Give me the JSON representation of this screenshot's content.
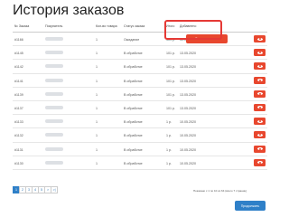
{
  "page_title": "История заказов",
  "columns": {
    "number": "№ Заказа",
    "buyer": "Покупатель",
    "qty": "Кол-во товара",
    "status": "Статус заказа",
    "sum": "Итого",
    "added": "Добавлено"
  },
  "rows": [
    {
      "num": "#1166",
      "qty": "1",
      "status": "Ожидание",
      "sum": "101 р.",
      "date": "30.05.2020"
    },
    {
      "num": "#1145",
      "qty": "1",
      "status": "В обработке",
      "sum": "101 р.",
      "date": "13.05.2020"
    },
    {
      "num": "#1142",
      "qty": "1",
      "status": "В обработке",
      "sum": "101 р.",
      "date": "13.05.2020"
    },
    {
      "num": "#1141",
      "qty": "1",
      "status": "В обработке",
      "sum": "101 р.",
      "date": "13.05.2020"
    },
    {
      "num": "#1139",
      "qty": "1",
      "status": "В обработке",
      "sum": "101 р.",
      "date": "13.05.2020"
    },
    {
      "num": "#1137",
      "qty": "1",
      "status": "В обработке",
      "sum": "101 р.",
      "date": "13.05.2020"
    },
    {
      "num": "#1133",
      "qty": "1",
      "status": "В обработке",
      "sum": "1 р.",
      "date": "10.05.2020"
    },
    {
      "num": "#1132",
      "qty": "1",
      "status": "В обработке",
      "sum": "1 р.",
      "date": "10.05.2020"
    },
    {
      "num": "#1131",
      "qty": "1",
      "status": "В обработке",
      "sum": "1 р.",
      "date": "10.05.2020"
    },
    {
      "num": "#1130",
      "qty": "1",
      "status": "В обработке",
      "sum": "1 р.",
      "date": "10.05.2020"
    }
  ],
  "cancel_button_label": "Отменить заказ",
  "pagination": [
    "1",
    "2",
    "3",
    "4",
    "5",
    ">",
    ">|"
  ],
  "summary_text": "Показано с 1 по 10 из 64 (всего 7 страниц)",
  "continue_button_label": "Продолжить",
  "colors": {
    "accent_red": "#e8472e",
    "accent_blue": "#2f80c8",
    "highlight": "#e53935"
  },
  "icons": {
    "view": "eye-icon"
  }
}
